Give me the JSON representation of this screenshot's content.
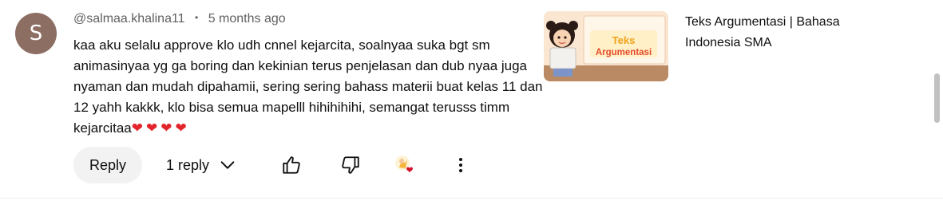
{
  "comment": {
    "avatar_letter": "S",
    "author": "@salmaa.khalina11",
    "separator": "•",
    "timestamp": "5 months ago",
    "text": "kaa aku selalu approve klo udh cnnel kejarcita, soalnyaa suka bgt sm animasinyaa yg ga boring dan kekinian terus penjelasan dan dub nyaa juga nyaman dan mudah dipahamii, sering sering bahass materii buat kelas 11 dan 12 yahh kakkk, klo bisa semua mapelll hihihihihi, semangat terusss timm kejarcitaa",
    "hearts": "❤❤❤❤",
    "colors": {
      "avatar_bg": "#8d6e63",
      "heart": "#e3242b"
    }
  },
  "actions": {
    "reply_label": "Reply",
    "replies_label": "1 reply",
    "icons": [
      "thumbs-up-icon",
      "thumbs-down-icon",
      "creator-heart-icon",
      "more-vert-icon"
    ]
  },
  "video": {
    "thumbnail_text_line1": "Teks",
    "thumbnail_text_line2": "Argumentasi",
    "title": "Teks Argumentasi | Bahasa Indonesia SMA"
  }
}
